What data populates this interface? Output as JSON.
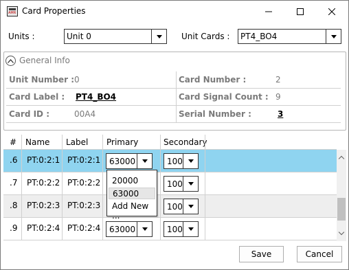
{
  "window": {
    "title": "Card Properties",
    "icon": "amr-app-icon",
    "icon_text": "AMR"
  },
  "top": {
    "units_label": "Units :",
    "units_value": "Unit 0",
    "unit_cards_label": "Unit Cards :",
    "unit_cards_value": "PT4_BO4"
  },
  "general_info": {
    "title": "General Info",
    "rows": [
      {
        "left_key": "Unit Number :",
        "left_val": "0",
        "right_key": "Card Number :",
        "right_val": "2"
      },
      {
        "left_key": "Card Label :",
        "left_val": "PT4_BO4",
        "right_key": "Card Signal Count :",
        "right_val": "9"
      },
      {
        "left_key": "Card ID :",
        "left_val": "00A4",
        "right_key": "Serial Number :",
        "right_val": "3"
      }
    ]
  },
  "grid": {
    "headers": [
      "#",
      "Name",
      "Label",
      "Primary",
      "Secondary"
    ],
    "rows": [
      {
        "num": ".6",
        "name": "PT:0:2:1",
        "label": "PT:0:2:1",
        "primary": "63000",
        "secondary": "100"
      },
      {
        "num": ".7",
        "name": "PT:0:2:2",
        "label": "PT:0:2:2",
        "primary": "",
        "secondary": "100"
      },
      {
        "num": ".8",
        "name": "PT:0:2:3",
        "label": "PT:0:2:3",
        "primary": "",
        "secondary": "100"
      },
      {
        "num": ".9",
        "name": "PT:0:2:4",
        "label": "PT:0:2:4",
        "primary": "63000",
        "secondary": "100"
      }
    ]
  },
  "primary_dropdown": {
    "options": [
      "20000",
      "63000",
      "Add New ..."
    ],
    "highlighted": "63000"
  },
  "buttons": {
    "save": "Save",
    "cancel": "Cancel"
  },
  "colors": {
    "selected_row": "#8fd4f0",
    "alt_row": "#eeeeee",
    "muted_text": "#7a7a7a"
  }
}
